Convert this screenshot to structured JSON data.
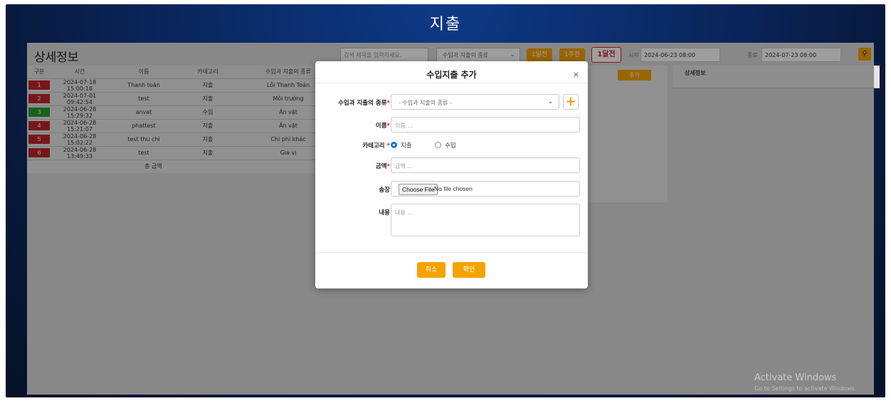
{
  "page": {
    "title": "지출"
  },
  "panel": {
    "title": "상세정보",
    "search_placeholder": "검색 제목을 입력하세요.",
    "type_select": "수입과 지출의 종류",
    "btn_1day": "1일전",
    "btn_1week": "1주전",
    "btn_1month": "1달전",
    "start_label": "시작",
    "start_value": "2024-06-23 08:00",
    "end_label": "종료",
    "end_value": "2024-07-23 08:00",
    "add_label": "추가",
    "detail_header": "상세정보"
  },
  "table": {
    "headers": [
      "구분",
      "시간",
      "이름",
      "카테고리",
      "수입과 지출의 종류"
    ],
    "rows": [
      {
        "num": "1",
        "color": "#c0262a",
        "time": "2024-07-18 15:00:18",
        "name": "Thanh toán",
        "category": "지출",
        "kind": "Lỗi Thanh Toán"
      },
      {
        "num": "2",
        "color": "#c0262a",
        "time": "2024-07-01 09:42:54",
        "name": "test",
        "category": "지출",
        "kind": "Môi trường"
      },
      {
        "num": "3",
        "color": "#2a9c2a",
        "time": "2024-06-28 15:29:32",
        "name": "anvat",
        "category": "수입",
        "kind": "Ăn vặt"
      },
      {
        "num": "4",
        "color": "#c0262a",
        "time": "2024-06-28 15:21:07",
        "name": "phattest",
        "category": "지출",
        "kind": "Ăn vặt"
      },
      {
        "num": "5",
        "color": "#c0262a",
        "time": "2024-06-28 15:02:22",
        "name": "test thu chi",
        "category": "지출",
        "kind": "Chi phí khác"
      },
      {
        "num": "6",
        "color": "#c0262a",
        "time": "2024-06-28 13:49:33",
        "name": "test",
        "category": "지출",
        "kind": "Gia vị"
      }
    ],
    "total_label": "총 금액"
  },
  "modal": {
    "title": "수입지출 추가",
    "close": "×",
    "type_label": "수입과 지출의 종류",
    "type_placeholder": "- 수입과 지출의 종류 -",
    "name_label": "이름",
    "name_placeholder": "이름 ...",
    "category_label": "카테고리",
    "radio_expense": "지출",
    "radio_income": "수입",
    "amount_label": "금액",
    "amount_placeholder": "금액 ...",
    "file_label": "송장",
    "file_button": "Choose File",
    "file_status": "No file chosen",
    "content_label": "내용",
    "content_placeholder": "내용 ...",
    "cancel": "취소",
    "confirm": "확인"
  },
  "watermark": {
    "line1": "Activate Windows",
    "line2": "Go to Settings to activate Windows."
  },
  "colors": {
    "accent": "#f5a300",
    "danger": "#d22222",
    "income": "#2a9c2a",
    "expense": "#c0262a"
  }
}
